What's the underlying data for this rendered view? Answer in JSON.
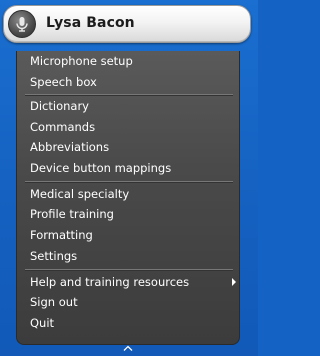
{
  "header": {
    "user_name": "Lysa Bacon",
    "mic_icon": "microphone-icon"
  },
  "menu": {
    "groups": [
      [
        "Microphone setup",
        "Speech box"
      ],
      [
        "Dictionary",
        "Commands",
        "Abbreviations",
        "Device button mappings"
      ],
      [
        "Medical specialty",
        "Profile training",
        "Formatting",
        "Settings"
      ],
      [
        "Help and training resources",
        "Sign out",
        "Quit"
      ]
    ],
    "submenu_item": "Help and training resources",
    "collapse_icon": "chevron-up-icon"
  },
  "colors": {
    "desktop": "#1463c4",
    "menu_bg": "#4a4a4a",
    "menu_text": "#ffffff"
  }
}
